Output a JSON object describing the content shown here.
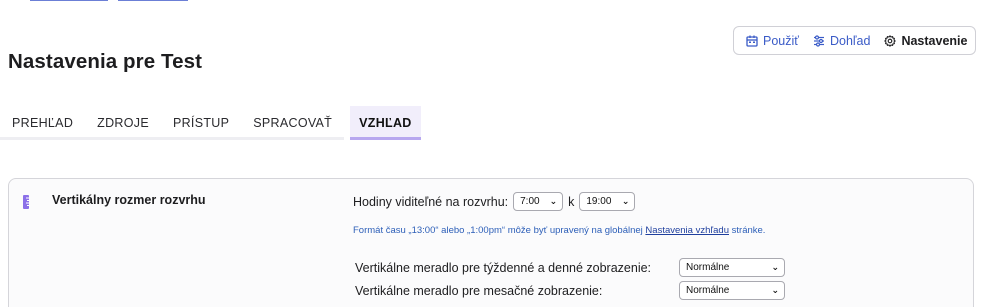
{
  "view_switch": {
    "items": [
      {
        "label": "Použiť",
        "icon": "calendar-icon",
        "active": false
      },
      {
        "label": "Dohľad",
        "icon": "sliders-icon",
        "active": false
      },
      {
        "label": "Nastavenie",
        "icon": "gear-icon",
        "active": true
      }
    ]
  },
  "page": {
    "title": "Nastavenia pre Test"
  },
  "tabs": [
    {
      "label": "PREHĽAD",
      "active": false
    },
    {
      "label": "ZDROJE",
      "active": false
    },
    {
      "label": "PRÍSTUP",
      "active": false
    },
    {
      "label": "SPRACOVAŤ",
      "active": false
    },
    {
      "label": "VZHĽAD",
      "active": true
    }
  ],
  "panel": {
    "title": "Vertikálny rozmer rozvrhu",
    "icon": "ruler-icon",
    "hours": {
      "label": "Hodiny viditeľné na rozvrhu:",
      "start": "7:00",
      "separator": "k",
      "end": "19:00"
    },
    "hint": {
      "before": "Formát času „13:00“ alebo „1:00pm“ môže byť upravený na globálnej",
      "link": "Nastavenia vzhľadu",
      "after": "stránke."
    },
    "weekly_scale": {
      "label": "Vertikálne meradlo pre týždenné a denné zobrazenie:",
      "value": "Normálne"
    },
    "monthly_scale": {
      "label": "Vertikálne meradlo pre mesačné zobrazenie:",
      "value": "Normálne"
    }
  },
  "colors": {
    "accent": "#3a5bc7",
    "tab_active_bg": "#f1eefb",
    "tab_active_border": "#b7a7ef",
    "icon_purple": "#8b6fe8"
  }
}
